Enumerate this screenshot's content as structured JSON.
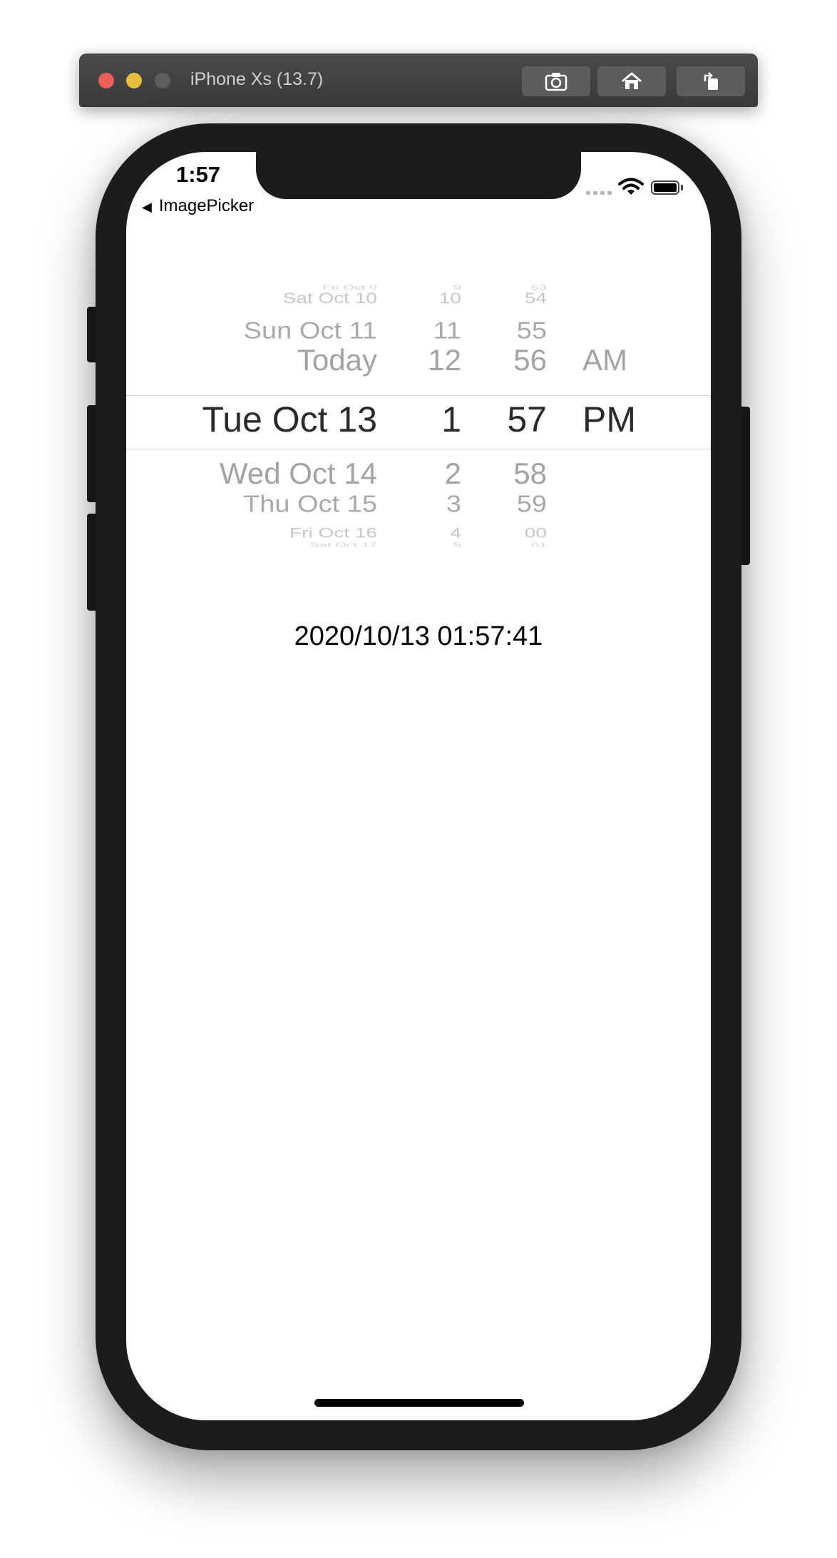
{
  "simulator": {
    "title": "iPhone Xs (13.7)",
    "buttons": [
      "screenshot-icon",
      "home-icon",
      "rotate-icon"
    ]
  },
  "status_bar": {
    "time": "1:57",
    "back_label": "ImagePicker"
  },
  "picker": {
    "dates": [
      "Fri Oct 9",
      "Sat Oct 10",
      "Sun Oct 11",
      "Today",
      "Tue Oct 13",
      "Wed Oct 14",
      "Thu Oct 15",
      "Fri Oct 16",
      "Sat Oct 17"
    ],
    "hours": [
      "9",
      "10",
      "11",
      "12",
      "1",
      "2",
      "3",
      "4",
      "5"
    ],
    "minutes": [
      "53",
      "54",
      "55",
      "56",
      "57",
      "58",
      "59",
      "00",
      "01"
    ],
    "ampm": [
      "AM",
      "PM"
    ],
    "selected": {
      "date": "Tue Oct 13",
      "hour": "1",
      "minute": "57",
      "ampm": "PM"
    }
  },
  "date_label": "2020/10/13 01:57:41"
}
